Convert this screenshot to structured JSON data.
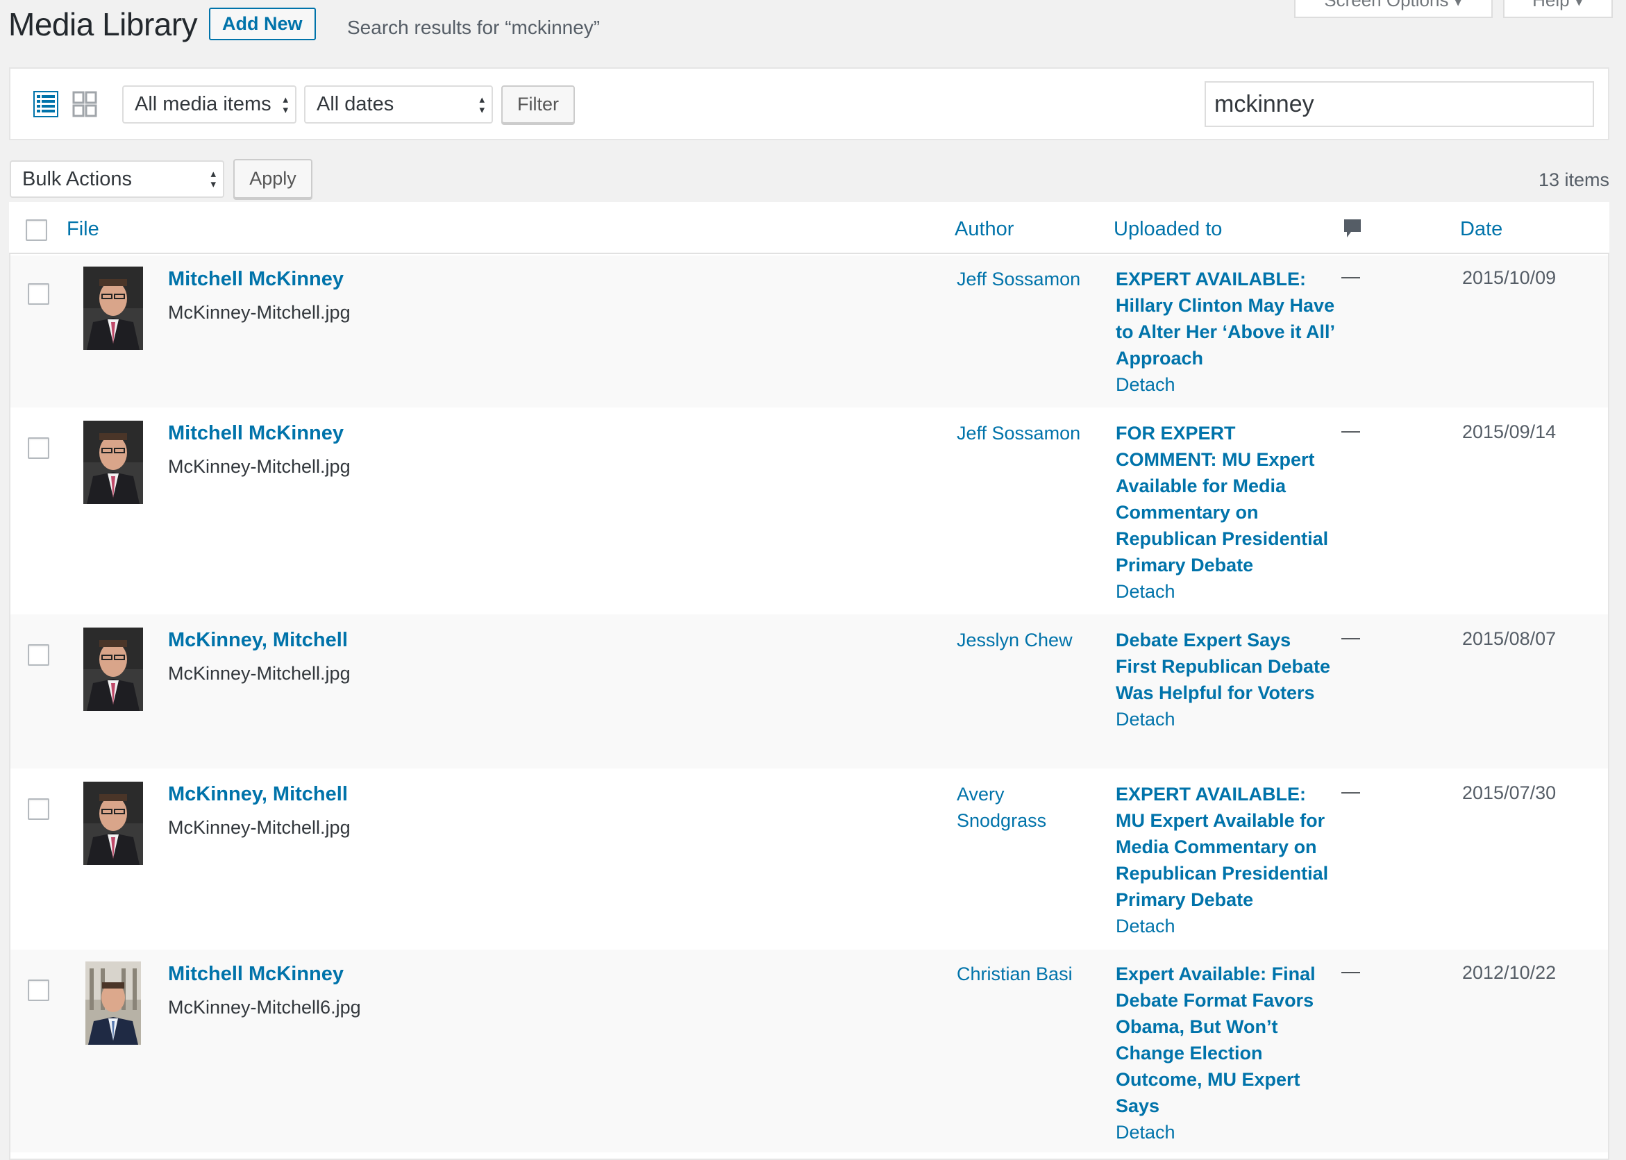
{
  "header": {
    "title": "Media Library",
    "add_new": "Add New",
    "search_results": "Search results for “mckinney”",
    "screen_options": "Screen Options ▾",
    "help": "Help ▾"
  },
  "filters": {
    "media_type": "All media items",
    "dates": "All dates",
    "filter_button": "Filter",
    "search_value": "mckinney"
  },
  "bulk": {
    "action": "Bulk Actions",
    "apply": "Apply",
    "count": "13 items"
  },
  "columns": {
    "file": "File",
    "author": "Author",
    "uploaded_to": "Uploaded to",
    "date": "Date"
  },
  "rows": [
    {
      "title": "Mitchell McKinney",
      "filename": "McKinney-Mitchell.jpg",
      "author": "Jeff Sossamon",
      "post": "EXPERT AVAILABLE: Hillary Clinton May Have to Alter Her ‘Above it All’ Approach",
      "detach": "Detach",
      "comments": "—",
      "date": "2015/10/09"
    },
    {
      "title": "Mitchell McKinney",
      "filename": "McKinney-Mitchell.jpg",
      "author": "Jeff Sossamon",
      "post": "FOR EXPERT COMMENT: MU Expert Available for Media Commentary on Republican Presidential Primary Debate",
      "detach": "Detach",
      "comments": "—",
      "date": "2015/09/14"
    },
    {
      "title": "McKinney, Mitchell",
      "filename": "McKinney-Mitchell.jpg",
      "author": "Jesslyn Chew",
      "post": "Debate Expert Says First Republican Debate Was Helpful for Voters",
      "detach": "Detach",
      "comments": "—",
      "date": "2015/08/07"
    },
    {
      "title": "McKinney, Mitchell",
      "filename": "McKinney-Mitchell.jpg",
      "author": "Avery Snodgrass",
      "post": "EXPERT AVAILABLE: MU Expert Available for Media Commentary on Republican Presidential Primary Debate",
      "detach": "Detach",
      "comments": "—",
      "date": "2015/07/30"
    },
    {
      "title": "Mitchell McKinney",
      "filename": "McKinney-Mitchell6.jpg",
      "author": "Christian Basi",
      "post": "Expert Available: Final Debate Format Favors Obama, But Won’t Change Election Outcome, MU Expert Says",
      "detach": "Detach",
      "comments": "—",
      "date": "2012/10/22"
    }
  ],
  "colors": {
    "link": "#0073aa",
    "background": "#f1f1f1",
    "text": "#23282d"
  }
}
